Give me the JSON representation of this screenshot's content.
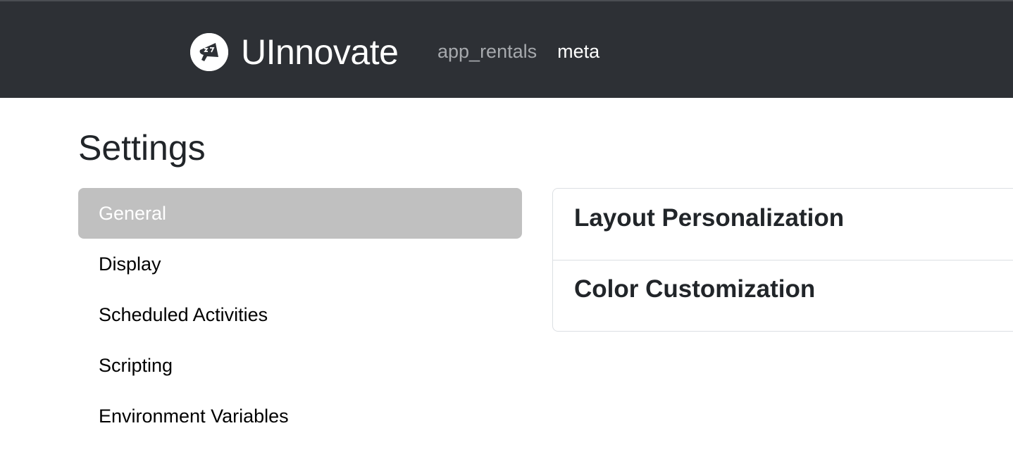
{
  "navbar": {
    "brand_name": "UInnovate",
    "logo_icon": "megaphone-logo-icon",
    "links": [
      {
        "label": "app_rentals",
        "active": false
      },
      {
        "label": "meta",
        "active": true
      }
    ]
  },
  "page": {
    "title": "Settings"
  },
  "settings_menu": {
    "items": [
      {
        "label": "General",
        "active": true
      },
      {
        "label": "Display",
        "active": false
      },
      {
        "label": "Scheduled Activities",
        "active": false
      },
      {
        "label": "Scripting",
        "active": false
      },
      {
        "label": "Environment Variables",
        "active": false
      }
    ]
  },
  "general_panel": {
    "sections": [
      {
        "title": "Layout Personalization"
      },
      {
        "title": "Color Customization"
      }
    ]
  },
  "colors": {
    "navbar_bg": "#2d3035",
    "active_menu_bg": "#c0c0c0",
    "nav_link_inactive": "#a6a9ad"
  }
}
